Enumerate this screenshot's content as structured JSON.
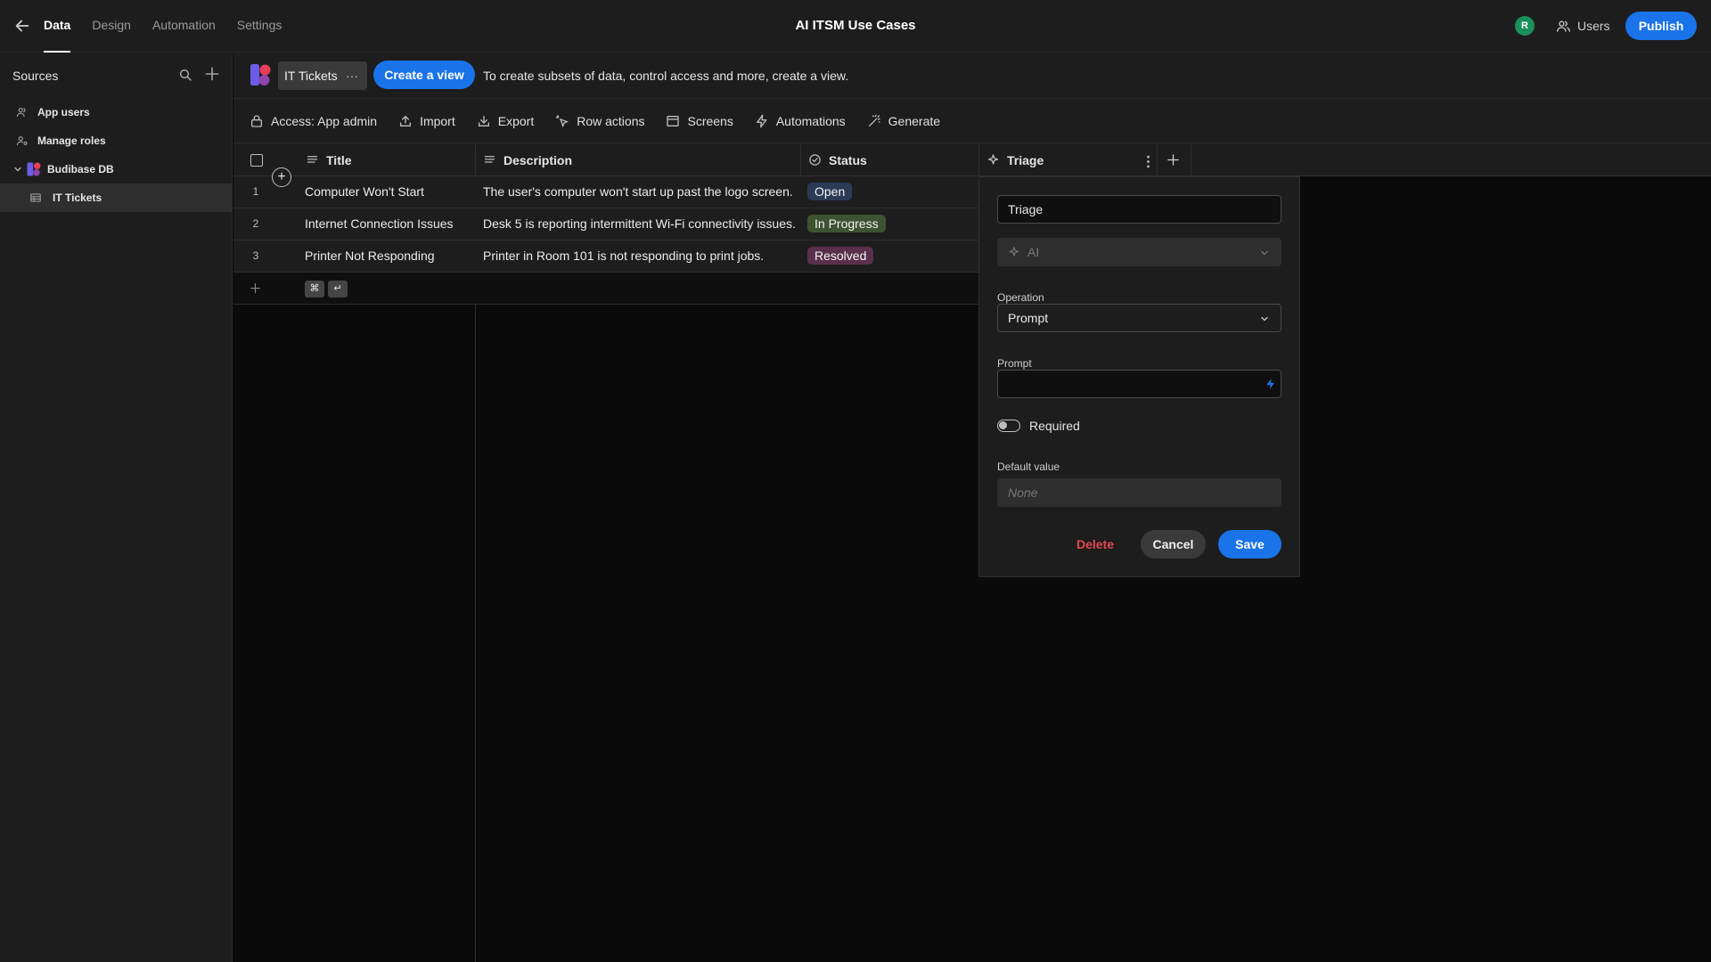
{
  "topbar": {
    "tabs": [
      "Data",
      "Design",
      "Automation",
      "Settings"
    ],
    "app_title": "AI ITSM Use Cases",
    "avatar_initial": "R",
    "users_label": "Users",
    "publish_label": "Publish"
  },
  "sidebar": {
    "heading": "Sources",
    "items": [
      "App users",
      "Manage roles",
      "Budibase DB",
      "IT Tickets"
    ]
  },
  "toolbar": {
    "table_tab": "IT Tickets",
    "tab_menu": "···",
    "create_view_label": "Create a view",
    "hint": "To create subsets of data, control access and more, create a view.",
    "actions": [
      "Access: App admin",
      "Import",
      "Export",
      "Row actions",
      "Screens",
      "Automations",
      "Generate"
    ]
  },
  "grid": {
    "columns": [
      "Title",
      "Description",
      "Status",
      "Triage"
    ],
    "rows": [
      {
        "num": "1",
        "title": "Computer Won't Start",
        "description": "The user's computer won't start up past the logo screen.",
        "status": "Open"
      },
      {
        "num": "2",
        "title": "Internet Connection Issues",
        "description": "Desk 5 is reporting intermittent Wi-Fi connectivity issues.",
        "status": "In Progress"
      },
      {
        "num": "3",
        "title": "Printer Not Responding",
        "description": "Printer in Room 101 is not responding to print jobs.",
        "status": "Resolved"
      }
    ],
    "shortcut_keys": [
      "⌘",
      "↵"
    ]
  },
  "status_colors": {
    "Open": "#2b3a55",
    "In Progress": "#3d5230",
    "Resolved": "#5a2f4b"
  },
  "panel": {
    "name_value": "Triage",
    "type_value": "AI",
    "operation_label": "Operation",
    "operation_value": "Prompt",
    "prompt_label": "Prompt",
    "prompt_value": "",
    "required_label": "Required",
    "default_label": "Default value",
    "default_placeholder": "None",
    "delete_label": "Delete",
    "cancel_label": "Cancel",
    "save_label": "Save"
  },
  "colors": {
    "accent": "#1a73e8",
    "danger": "#e5484d"
  }
}
